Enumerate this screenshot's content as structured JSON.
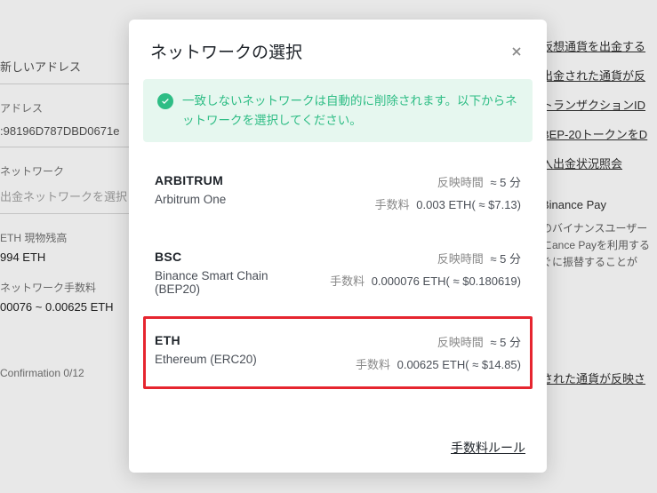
{
  "background": {
    "left": {
      "new_address_tab": "新しいアドレス",
      "address_label": "アドレス",
      "address_value": ":98196D787DBD0671e",
      "network_label": "ネットワーク",
      "network_placeholder": "出金ネットワークを選択",
      "balance_label": "ETH 現物残高",
      "balance_value": "994 ETH",
      "fee_label": "ネットワーク手数料",
      "fee_value": "00076 ~ 0.00625 ETH",
      "confirmation": "Confirmation 0/12"
    },
    "right": {
      "links": [
        "仮想通貨を出金する",
        "出金された通貨が反",
        "トランザクションID",
        "BEP-20トークンをD",
        "入出金状況照会"
      ],
      "pay_title": "Binance Pay",
      "pay_desc": "のバイナンスユーザーにance Payを利用するぐに振替することが",
      "bottom": "された通貨が反映さ"
    }
  },
  "modal": {
    "title": "ネットワークの選択",
    "info": "一致しないネットワークは自動的に削除されます。以下からネットワークを選択してください。",
    "time_label": "反映時間",
    "fee_label": "手数料",
    "networks": [
      {
        "symbol": "ARBITRUM",
        "name": "Arbitrum One",
        "time": "≈ 5 分",
        "fee": "0.003 ETH( ≈ $7.13)",
        "highlighted": false
      },
      {
        "symbol": "BSC",
        "name": "Binance Smart Chain (BEP20)",
        "time": "≈ 5 分",
        "fee": "0.000076 ETH( ≈ $0.180619)",
        "highlighted": false
      },
      {
        "symbol": "ETH",
        "name": "Ethereum (ERC20)",
        "time": "≈ 5 分",
        "fee": "0.00625 ETH( ≈ $14.85)",
        "highlighted": true
      }
    ],
    "footer_link": "手数料ルール"
  }
}
